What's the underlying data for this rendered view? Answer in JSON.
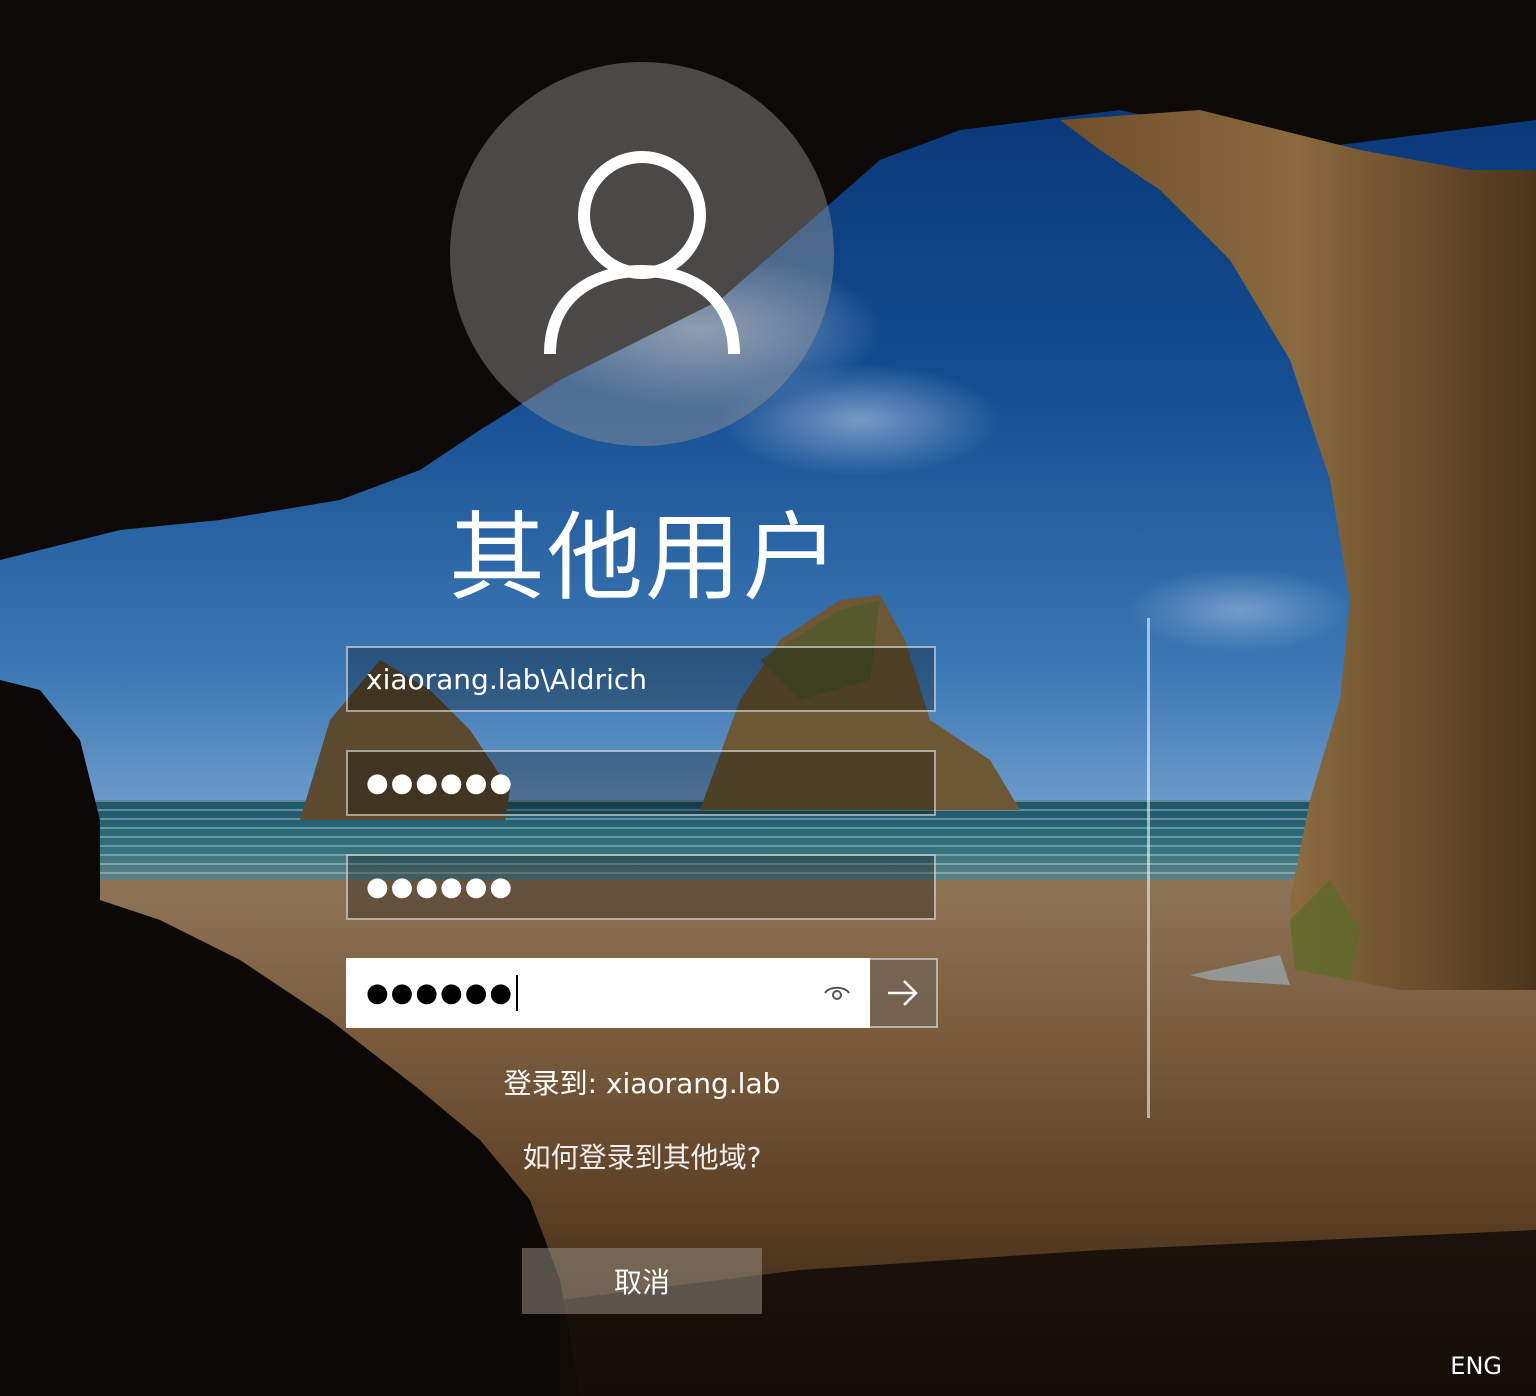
{
  "login": {
    "title": "其他用户",
    "username_value": "xiaorang.lab\\Aldrich",
    "password_1_value": "●●●●●●",
    "password_2_value": "●●●●●●",
    "password_3_value": "●●●●●●",
    "sign_in_to": "登录到: xiaorang.lab",
    "help_link": "如何登录到其他域?",
    "cancel_label": "取消"
  },
  "taskbar": {
    "language": "ENG"
  },
  "icons": {
    "avatar": "user-icon",
    "reveal": "eye-icon",
    "submit": "arrow-right-icon"
  }
}
